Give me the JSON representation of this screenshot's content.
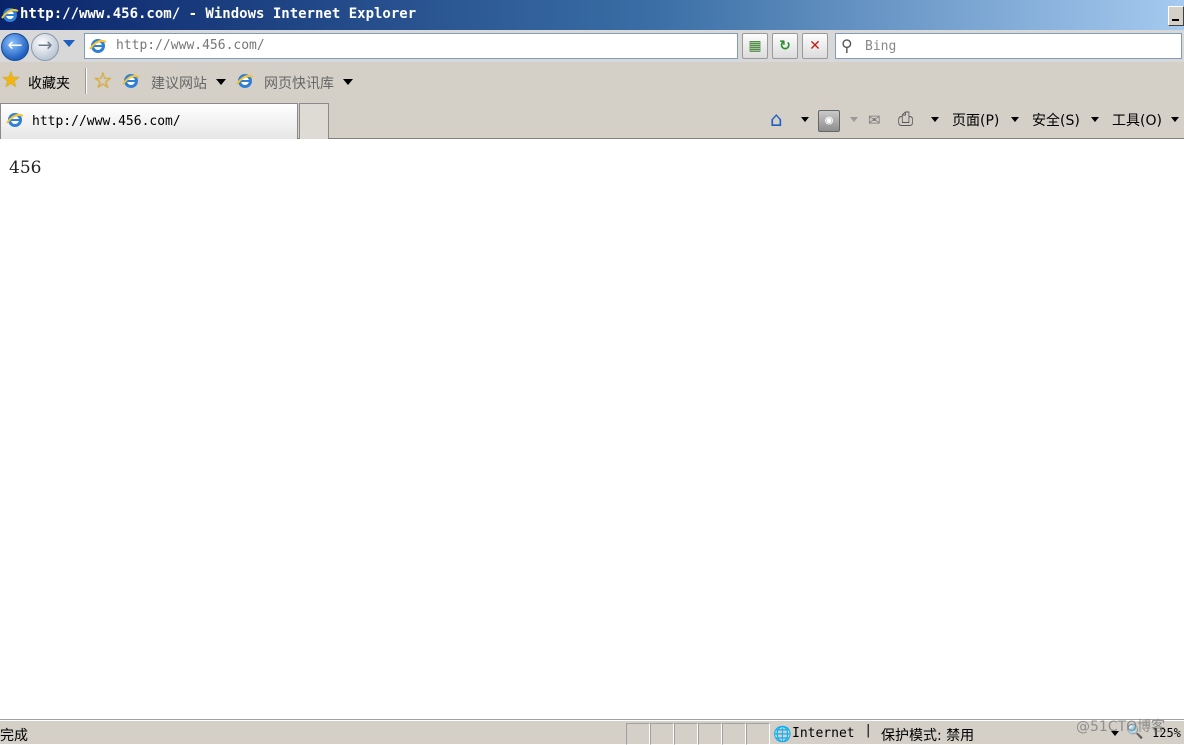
{
  "window": {
    "title": "http://www.456.com/ - Windows Internet Explorer"
  },
  "address_bar": {
    "url": "http://www.456.com/"
  },
  "search": {
    "placeholder": "Bing"
  },
  "favorites_bar": {
    "favorites_label": "收藏夹",
    "items": [
      {
        "label": "建议网站"
      },
      {
        "label": "网页快讯库"
      }
    ]
  },
  "tabs": [
    {
      "label": "http://www.456.com/"
    }
  ],
  "command_bar": {
    "page_label": "页面(P)",
    "safety_label": "安全(S)",
    "tools_label": "工具(O)"
  },
  "content": {
    "body_text": "456"
  },
  "status_bar": {
    "status_text": "完成",
    "zone_text": "Internet",
    "zone_separator": "|",
    "protected_mode_text": "保护模式: 禁用",
    "zoom_text": "125%"
  },
  "watermark": {
    "text": "@51CTO博客"
  },
  "icons": {
    "app": "ie-logo-icon",
    "back": "back-arrow-icon",
    "forward": "forward-arrow-icon",
    "refresh": "refresh-icon",
    "stop": "stop-icon",
    "search": "magnifier-icon",
    "favorites": "star-icon",
    "home": "home-icon",
    "feeds": "rss-feed-icon",
    "mail": "mail-icon",
    "print": "printer-icon",
    "zone": "globe-icon"
  },
  "colors": {
    "titlebar_start": "#0a246a",
    "titlebar_end": "#a6caf0",
    "chrome": "#d4d0c8"
  }
}
